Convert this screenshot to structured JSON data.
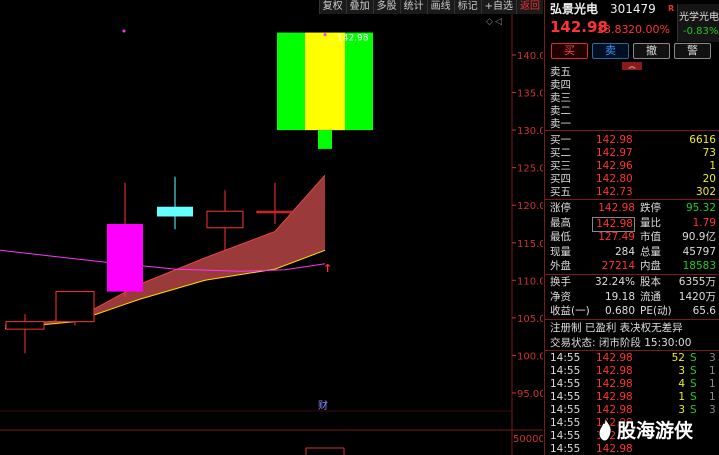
{
  "toolbar": {
    "items": [
      "复权",
      "叠加",
      "多股",
      "统计",
      "画线",
      "标记",
      "+自选",
      "返回"
    ]
  },
  "chart": {
    "y_ticks": [
      "140.0",
      "135.0",
      "130.0",
      "125.0",
      "120.0",
      "115.0",
      "110.0",
      "105.0",
      "100.0",
      "95.00"
    ],
    "volume_tick": "50000",
    "max_price_label": "142.98",
    "finance_marker": "财",
    "colors": {
      "up": "#ff3333",
      "ma_pink": "#ff33ff",
      "ma_yellow": "#ffdd00",
      "band": "#9a3a3a"
    }
  },
  "chart_data": {
    "type": "candlestick",
    "y_range": [
      93,
      143
    ],
    "candles": [
      {
        "o": 103.5,
        "c": 104.5,
        "h": 105.5,
        "l": 100.3,
        "color": "hollow-red"
      },
      {
        "o": 104.5,
        "c": 108.5,
        "h": 108.5,
        "l": 104.0,
        "color": "hollow-red"
      },
      {
        "o": 108.5,
        "c": 117.5,
        "h": 123.0,
        "l": 107.8,
        "color": "magenta"
      },
      {
        "o": 119.8,
        "c": 118.5,
        "h": 123.8,
        "l": 116.8,
        "color": "cyan"
      },
      {
        "o": 117.0,
        "c": 119.2,
        "h": 122.0,
        "l": 114.0,
        "color": "hollow-red"
      },
      {
        "o": 119.0,
        "c": 119.2,
        "h": 123.0,
        "l": 117.5,
        "color": "hollow-red"
      },
      {
        "o": 130.0,
        "c": 142.98,
        "h": 142.98,
        "l": 127.5,
        "color": "limit-up"
      }
    ],
    "band_upper": [
      104.0,
      104.8,
      109.5,
      113.0,
      116.5,
      124.0
    ],
    "band_lower": [
      103.6,
      104.5,
      107.5,
      110.0,
      111.5,
      114.0
    ],
    "ma_pink": [
      114.0,
      112.5,
      111.5,
      111.2,
      111.4,
      112.2
    ]
  },
  "panel": {
    "stock_name": "弘景光电",
    "stock_code": "301479",
    "r_mark": "R",
    "sector": {
      "name": "光学光电",
      "pct": "-0.83%"
    },
    "last_price": "142.98",
    "change": "23.83",
    "change_pct": "20.00%",
    "buttons": {
      "buy": "买",
      "sell": "卖",
      "cancel": "撤",
      "warn": "警"
    },
    "sell_levels": [
      {
        "label": "卖五",
        "price": "",
        "vol": ""
      },
      {
        "label": "卖四",
        "price": "",
        "vol": ""
      },
      {
        "label": "卖三",
        "price": "",
        "vol": ""
      },
      {
        "label": "卖二",
        "price": "",
        "vol": ""
      },
      {
        "label": "卖一",
        "price": "",
        "vol": ""
      }
    ],
    "buy_levels": [
      {
        "label": "买一",
        "price": "142.98",
        "vol": "6616"
      },
      {
        "label": "买二",
        "price": "142.97",
        "vol": "73"
      },
      {
        "label": "买三",
        "price": "142.96",
        "vol": "1"
      },
      {
        "label": "买四",
        "price": "142.80",
        "vol": "20"
      },
      {
        "label": "买五",
        "price": "142.73",
        "vol": "302"
      }
    ],
    "stats": [
      {
        "l1": "涨停",
        "v1": "142.98",
        "c1": "red",
        "l2": "跌停",
        "v2": "95.32",
        "c2": "green"
      },
      {
        "l1": "最高",
        "v1": "142.98",
        "c1": "red",
        "l2": "量比",
        "v2": "1.79",
        "c2": "red"
      },
      {
        "l1": "最低",
        "v1": "127.49",
        "c1": "red",
        "l2": "市值",
        "v2": "90.9亿",
        "c2": "white"
      },
      {
        "l1": "现量",
        "v1": "284",
        "c1": "white",
        "l2": "总量",
        "v2": "45797",
        "c2": "white"
      },
      {
        "l1": "外盘",
        "v1": "27214",
        "c1": "red",
        "l2": "内盘",
        "v2": "18583",
        "c2": "green"
      }
    ],
    "stats2": [
      {
        "l1": "换手",
        "v1": "32.24%",
        "c1": "white",
        "l2": "股本",
        "v2": "6355万",
        "c2": "white"
      },
      {
        "l1": "净资",
        "v1": "19.18",
        "c1": "white",
        "l2": "流通",
        "v2": "1420万",
        "c2": "white"
      },
      {
        "l1": "收益(一)",
        "v1": "0.680",
        "c1": "white",
        "l2": "PE(动)",
        "v2": "65.6",
        "c2": "white"
      }
    ],
    "tags": "注册制 已盈利 表决权无差异",
    "status": "交易状态: 闭市阶段 15:30:00",
    "ticks": [
      {
        "time": "14:55",
        "price": "142.98",
        "vol": "52",
        "dir": "S",
        "cnt": "3"
      },
      {
        "time": "14:55",
        "price": "142.98",
        "vol": "3",
        "dir": "S",
        "cnt": "1"
      },
      {
        "time": "14:55",
        "price": "142.98",
        "vol": "4",
        "dir": "S",
        "cnt": "1"
      },
      {
        "time": "14:55",
        "price": "142.98",
        "vol": "1",
        "dir": "S",
        "cnt": "1"
      },
      {
        "time": "14:55",
        "price": "142.98",
        "vol": "3",
        "dir": "S",
        "cnt": "3"
      },
      {
        "time": "14:55",
        "price": "142.98",
        "vol": "",
        "dir": "",
        "cnt": ""
      },
      {
        "time": "14:55",
        "price": "142.98",
        "vol": "",
        "dir": "",
        "cnt": ""
      },
      {
        "time": "14:55",
        "price": "142.98",
        "vol": "",
        "dir": "",
        "cnt": ""
      }
    ]
  },
  "watermark": {
    "text": "股海游侠",
    "icon": "flame-icon"
  }
}
